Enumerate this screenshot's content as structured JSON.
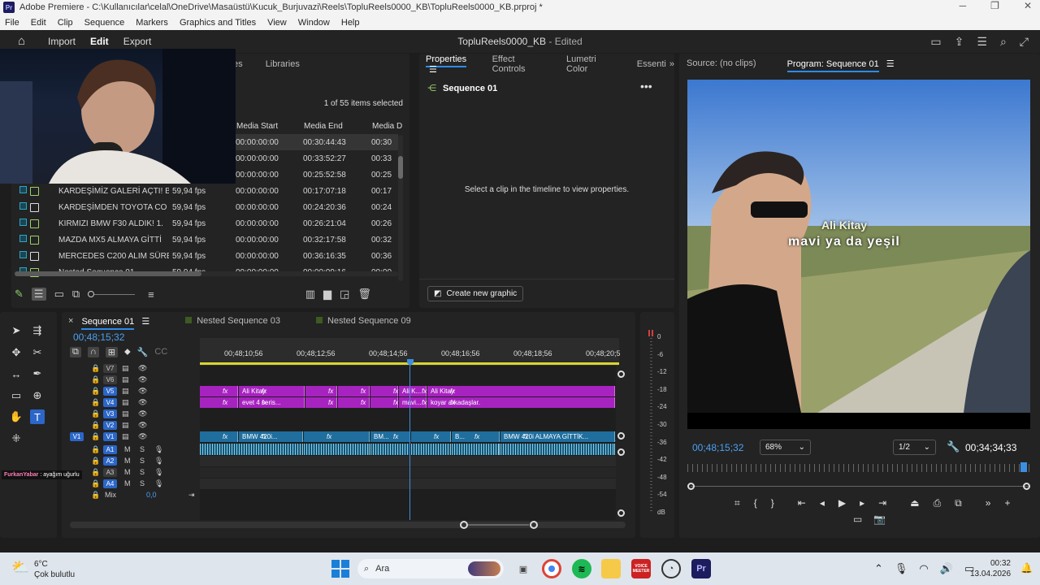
{
  "window": {
    "app_icon": "Pr",
    "title": "Adobe Premiere - C:\\Kullanıcılar\\celal\\OneDrive\\Masaüstü\\Kucuk_Burjuvazi\\Reels\\TopluReels0000_KB\\TopluReels0000_KB.prproj *"
  },
  "menu": [
    "File",
    "Edit",
    "Clip",
    "Sequence",
    "Markers",
    "Graphics and Titles",
    "View",
    "Window",
    "Help"
  ],
  "topbar": {
    "nav": [
      "Import",
      "Edit",
      "Export"
    ],
    "project_title": "TopluReels0000_KB",
    "edited_label": "- Edited"
  },
  "project_panel": {
    "tabs": [
      "tes",
      "Libraries"
    ],
    "selection_count": "1 of 55 items selected",
    "columns": [
      "Media Start",
      "Media End",
      "Media D"
    ],
    "rows": [
      {
        "name": "",
        "fps": "",
        "start": "00:00:00:00",
        "end": "00:30:44:43",
        "dur": "00:30",
        "type": "seq",
        "selected": true
      },
      {
        "name": "",
        "fps": "",
        "start": "00:00:00:00",
        "end": "00:33:52:27",
        "dur": "00:33",
        "type": "seq",
        "selected": false
      },
      {
        "name": "",
        "fps": "",
        "start": "00:00:00:00",
        "end": "00:25:52:58",
        "dur": "00:25",
        "type": "seq",
        "selected": false
      },
      {
        "name": "KARDEŞİMİZ GALERİ AÇTI! B",
        "fps": "59,94 fps",
        "start": "00:00:00:00",
        "end": "00:17:07:18",
        "dur": "00:17",
        "type": "seq",
        "selected": false
      },
      {
        "name": "KARDEŞİMDEN TOYOTA CO",
        "fps": "59,94 fps",
        "start": "00:00:00:00",
        "end": "00:24:20:36",
        "dur": "00:24",
        "type": "doc",
        "selected": false
      },
      {
        "name": "KIRMIZI BMW F30 ALDIK! 1.",
        "fps": "59,94 fps",
        "start": "00:00:00:00",
        "end": "00:26:21:04",
        "dur": "00:26",
        "type": "seq",
        "selected": false
      },
      {
        "name": "MAZDA MX5 ALMAYA GİTTİ",
        "fps": "59,94 fps",
        "start": "00:00:00:00",
        "end": "00:32:17:58",
        "dur": "00:32",
        "type": "seq",
        "selected": false
      },
      {
        "name": "MERCEDES C200 ALIM SÜRE",
        "fps": "59,94 fps",
        "start": "00:00:00:00",
        "end": "00:36:16:35",
        "dur": "00:36",
        "type": "doc",
        "selected": false
      },
      {
        "name": "Nested Sequence 01",
        "fps": "59,94 fps",
        "start": "00:00:00:00",
        "end": "00:00:09:16",
        "dur": "00:00",
        "type": "nest",
        "selected": false
      }
    ]
  },
  "properties_panel": {
    "tabs": [
      "Properties",
      "Effect Controls",
      "Lumetri Color",
      "Essenti"
    ],
    "sequence_name": "Sequence 01",
    "empty_message": "Select a clip in the timeline to view properties.",
    "create_button": "Create new graphic"
  },
  "monitor": {
    "source_tab": "Source: (no clips)",
    "program_tab": "Program: Sequence 01",
    "caption_line1": "Ali Kitay",
    "caption_line2": "mavi ya da yeşil",
    "timecode_left": "00;48;15;32",
    "zoom": "68%",
    "resolution": "1/2",
    "timecode_right": "00;34;34;33"
  },
  "timeline": {
    "tabs": [
      "Sequence 01",
      "Nested Sequence 03",
      "Nested Sequence 09"
    ],
    "timecode": "00;48;15;32",
    "ruler": [
      "00;48;10;56",
      "00;48;12;56",
      "00;48;14;56",
      "00;48;16;56",
      "00;48;18;56",
      "00;48;20;5"
    ],
    "video_tracks": [
      "V7",
      "V6",
      "V5",
      "V4",
      "V3",
      "V2",
      "V1"
    ],
    "audio_tracks": [
      "A1",
      "A2",
      "A3",
      "A4"
    ],
    "mix_label": "Mix",
    "mix_value": "0,0",
    "mute_label": "M",
    "solo_label": "S",
    "source_patch": "V1",
    "clips_v5": [
      "Ali Kitay",
      "Ali K...",
      "Ali Kitay"
    ],
    "clips_v4": [
      "evet 4 seris...",
      "mavi...",
      "koyar arkadaşlar."
    ],
    "clips_v1": [
      "BMW 420i...",
      "BM...",
      "B...",
      "BMW 420i ALMAYA GİTTİK..."
    ],
    "fx": "fx"
  },
  "meter": {
    "labels": [
      "0",
      "-6",
      "-12",
      "-18",
      "-24",
      "-30",
      "-36",
      "-42",
      "-48",
      "-54",
      "dB"
    ]
  },
  "webcam_overlay": {
    "name": "FurkanYabar",
    "status": ": ayağım uğurlu"
  },
  "taskbar": {
    "weather_temp": "6°C",
    "weather_desc": "Çok bulutlu",
    "search": "Ara",
    "voicemeeter": "VOICE MEETER",
    "time": "00:32",
    "date": "13.04.2026"
  },
  "colors": {
    "accent": "#2d8ceb",
    "pink_clip": "#a723c0",
    "video_clip": "#1f6e9e",
    "audio_clip": "#1a5573",
    "playhead": "#3c8fe0"
  }
}
